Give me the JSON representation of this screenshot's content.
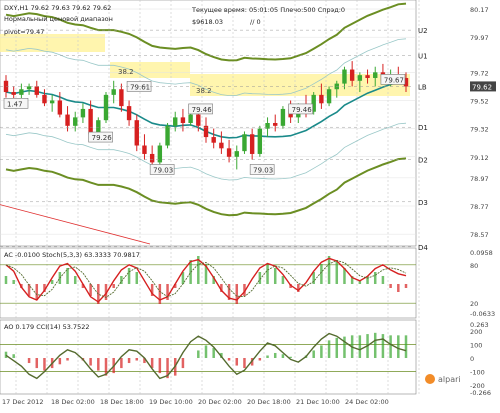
{
  "header": {
    "symbol_line": "DXY,H1  79.62 79.63 79.62 79.62",
    "subtitle": "Нормальный ценовой диапазон",
    "pivot_label": "pivot=79.47",
    "time_label": "Текущее время: 05:01:05 Плечо:500 Спрэд:0",
    "balance": "$9618.03",
    "balance_suffix": "// 0"
  },
  "chart_data": [
    {
      "type": "candlestick",
      "title": "DXY,H1",
      "x_ticks": [
        "17 Dec 2012",
        "18 Dec 02:00",
        "18 Dec 18:00",
        "19 Dec 10:00",
        "20 Dec 02:00",
        "20 Dec 18:00",
        "21 Dec 10:00",
        "24 Dec 02:00"
      ],
      "y_ticks": [
        "80.17",
        "79.97",
        "79.72",
        "79.52",
        "79.32",
        "79.12",
        "78.97",
        "78.77",
        "78.57"
      ],
      "ylim": [
        78.5,
        80.22
      ],
      "current_price": "79.62",
      "current_price_value": 79.62,
      "pivot_levels": [
        {
          "name": "U2",
          "value": 80.02
        },
        {
          "name": "U1",
          "value": 79.84
        },
        {
          "name": "LB",
          "value": 79.62
        },
        {
          "name": "D1",
          "value": 79.33
        },
        {
          "name": "D2",
          "value": 79.1
        },
        {
          "name": "D3",
          "value": 78.8
        },
        {
          "name": "D4",
          "value": 78.48
        }
      ],
      "fib_labels": [
        "38.2",
        "38.2"
      ],
      "annotations": [
        {
          "text": "79.61",
          "x": 16,
          "y": 79.62
        },
        {
          "text": "79.26",
          "x": 11,
          "y": 79.26
        },
        {
          "text": "79.46",
          "x": 24,
          "y": 79.46
        },
        {
          "text": "79.03",
          "x": 19,
          "y": 79.03
        },
        {
          "text": "79.03",
          "x": 32,
          "y": 79.03
        },
        {
          "text": "79.46",
          "x": 37,
          "y": 79.46
        },
        {
          "text": "79.67",
          "x": 49,
          "y": 79.67
        },
        {
          "text": "1.47",
          "x": 0,
          "y": 79.5
        }
      ],
      "ohlc": [
        [
          79.66,
          79.7,
          79.54,
          79.58
        ],
        [
          79.58,
          79.62,
          79.5,
          79.56
        ],
        [
          79.56,
          79.64,
          79.52,
          79.6
        ],
        [
          79.6,
          79.64,
          79.56,
          79.62
        ],
        [
          79.62,
          79.66,
          79.54,
          79.56
        ],
        [
          79.56,
          79.6,
          79.48,
          79.5
        ],
        [
          79.5,
          79.56,
          79.44,
          79.52
        ],
        [
          79.52,
          79.58,
          79.4,
          79.42
        ],
        [
          79.42,
          79.48,
          79.3,
          79.34
        ],
        [
          79.34,
          79.44,
          79.3,
          79.4
        ],
        [
          79.4,
          79.5,
          79.36,
          79.46
        ],
        [
          79.46,
          79.52,
          79.24,
          79.28
        ],
        [
          79.28,
          79.4,
          79.26,
          79.38
        ],
        [
          79.38,
          79.58,
          79.36,
          79.56
        ],
        [
          79.56,
          79.66,
          79.5,
          79.6
        ],
        [
          79.6,
          79.64,
          79.44,
          79.48
        ],
        [
          79.48,
          79.52,
          79.34,
          79.38
        ],
        [
          79.38,
          79.42,
          79.16,
          79.2
        ],
        [
          79.2,
          79.28,
          79.1,
          79.14
        ],
        [
          79.14,
          79.2,
          79.03,
          79.08
        ],
        [
          79.08,
          79.22,
          79.06,
          79.2
        ],
        [
          79.2,
          79.36,
          79.18,
          79.34
        ],
        [
          79.34,
          79.44,
          79.3,
          79.4
        ],
        [
          79.4,
          79.46,
          79.3,
          79.36
        ],
        [
          79.36,
          79.48,
          79.34,
          79.42
        ],
        [
          79.42,
          79.46,
          79.3,
          79.34
        ],
        [
          79.34,
          79.4,
          79.22,
          79.26
        ],
        [
          79.26,
          79.32,
          79.18,
          79.22
        ],
        [
          79.22,
          79.3,
          79.14,
          79.18
        ],
        [
          79.18,
          79.24,
          79.08,
          79.12
        ],
        [
          79.12,
          79.2,
          79.03,
          79.16
        ],
        [
          79.16,
          79.3,
          79.14,
          79.28
        ],
        [
          79.28,
          79.32,
          79.1,
          79.14
        ],
        [
          79.14,
          79.34,
          79.12,
          79.32
        ],
        [
          79.32,
          79.4,
          79.26,
          79.36
        ],
        [
          79.36,
          79.42,
          79.3,
          79.34
        ],
        [
          79.34,
          79.48,
          79.32,
          79.46
        ],
        [
          79.46,
          79.52,
          79.36,
          79.4
        ],
        [
          79.4,
          79.5,
          79.36,
          79.48
        ],
        [
          79.48,
          79.56,
          79.4,
          79.44
        ],
        [
          79.44,
          79.58,
          79.42,
          79.56
        ],
        [
          79.56,
          79.64,
          79.46,
          79.5
        ],
        [
          79.5,
          79.62,
          79.48,
          79.6
        ],
        [
          79.6,
          79.66,
          79.54,
          79.64
        ],
        [
          79.64,
          79.76,
          79.6,
          79.74
        ],
        [
          79.74,
          79.8,
          79.62,
          79.66
        ],
        [
          79.66,
          79.72,
          79.58,
          79.7
        ],
        [
          79.7,
          79.74,
          79.64,
          79.68
        ],
        [
          79.68,
          79.76,
          79.62,
          79.72
        ],
        [
          79.72,
          79.78,
          79.64,
          79.66
        ],
        [
          79.66,
          79.74,
          79.62,
          79.7
        ],
        [
          79.7,
          79.76,
          79.64,
          79.68
        ],
        [
          79.68,
          79.72,
          79.58,
          79.62
        ]
      ]
    },
    {
      "type": "line",
      "title": "AC -0.0100 Stoch(5,3,3) 63.3333 70.9817",
      "y_ticks": [
        "0.0958",
        "80",
        "20",
        "-0.0633"
      ],
      "series": [
        {
          "name": "Stoch",
          "values": [
            80,
            70,
            45,
            30,
            25,
            40,
            60,
            78,
            82,
            70,
            50,
            30,
            22,
            35,
            55,
            72,
            80,
            75,
            55,
            35,
            25,
            30,
            50,
            70,
            85,
            88,
            78,
            60,
            40,
            28,
            25,
            38,
            58,
            75,
            82,
            78,
            65,
            48,
            40,
            52,
            70,
            84,
            90,
            86,
            74,
            60,
            55,
            62,
            74,
            80,
            72,
            66,
            63
          ]
        }
      ],
      "histogram": [
        0.02,
        0.01,
        -0.01,
        -0.03,
        -0.04,
        -0.02,
        0.01,
        0.03,
        0.04,
        0.02,
        -0.01,
        -0.03,
        -0.05,
        -0.04,
        -0.01,
        0.02,
        0.04,
        0.03,
        0.0,
        -0.03,
        -0.05,
        -0.04,
        -0.01,
        0.03,
        0.06,
        0.07,
        0.05,
        0.02,
        -0.02,
        -0.04,
        -0.05,
        -0.03,
        0.0,
        0.03,
        0.05,
        0.04,
        0.02,
        -0.01,
        -0.02,
        0.0,
        0.03,
        0.05,
        0.07,
        0.06,
        0.04,
        0.02,
        0.01,
        0.02,
        0.03,
        0.02,
        -0.01,
        -0.02,
        -0.01
      ]
    },
    {
      "type": "line",
      "title": "AO 0.179 CCI(14) 53.7522",
      "y_ticks": [
        "0.263",
        "200",
        "100",
        "0",
        "-100",
        "-200",
        "-0.266"
      ],
      "series": [
        {
          "name": "CCI",
          "values": [
            20,
            -20,
            -60,
            -120,
            -150,
            -100,
            -40,
            20,
            60,
            40,
            -10,
            -80,
            -140,
            -120,
            -60,
            10,
            60,
            50,
            0,
            -80,
            -150,
            -130,
            -60,
            40,
            120,
            160,
            130,
            80,
            10,
            -60,
            -120,
            -90,
            -20,
            50,
            110,
            90,
            40,
            -10,
            -30,
            10,
            80,
            140,
            180,
            160,
            120,
            80,
            60,
            90,
            130,
            140,
            100,
            70,
            54
          ]
        }
      ],
      "histogram": [
        0.05,
        0.03,
        0.0,
        -0.04,
        -0.08,
        -0.1,
        -0.08,
        -0.05,
        -0.02,
        0.0,
        -0.02,
        -0.06,
        -0.1,
        -0.14,
        -0.12,
        -0.08,
        -0.04,
        -0.02,
        -0.04,
        -0.08,
        -0.12,
        -0.16,
        -0.14,
        -0.08,
        0.0,
        0.06,
        0.1,
        0.08,
        0.04,
        -0.02,
        -0.06,
        -0.08,
        -0.06,
        -0.02,
        0.02,
        0.04,
        0.03,
        0.01,
        0.0,
        0.02,
        0.06,
        0.1,
        0.14,
        0.16,
        0.17,
        0.18,
        0.18,
        0.19,
        0.2,
        0.19,
        0.18,
        0.18,
        0.18
      ]
    }
  ],
  "watermark": "alpari",
  "colors": {
    "bull": "#3aa832",
    "bear": "#d62020",
    "ma_teal": "#1a8a8a",
    "band_olive": "#6b8e23",
    "fib_yellow": "#fff3a0",
    "grid": "#c8c8c8",
    "stoch": "#d62020"
  }
}
